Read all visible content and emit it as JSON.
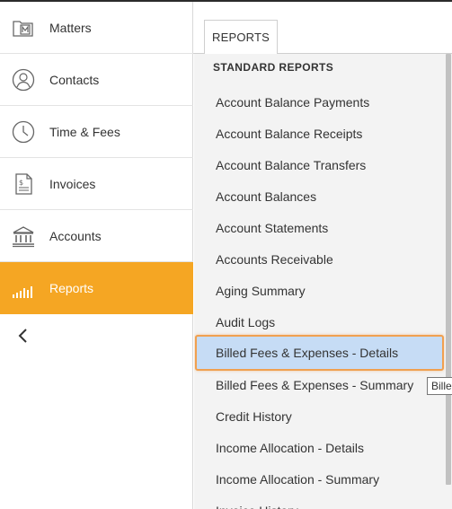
{
  "sidebar": {
    "items": [
      {
        "label": "Matters",
        "icon": "matters-icon"
      },
      {
        "label": "Contacts",
        "icon": "contacts-icon"
      },
      {
        "label": "Time & Fees",
        "icon": "clock-icon"
      },
      {
        "label": "Invoices",
        "icon": "invoice-icon"
      },
      {
        "label": "Accounts",
        "icon": "bank-icon"
      },
      {
        "label": "Reports",
        "icon": "bar-chart-icon",
        "active": true
      }
    ],
    "collapse_icon": "chevron-left-icon"
  },
  "tabs": [
    {
      "label": "REPORTS",
      "active": true
    }
  ],
  "panel": {
    "header": "STANDARD REPORTS",
    "items": [
      "Account Balance Payments",
      "Account Balance Receipts",
      "Account Balance Transfers",
      "Account Balances",
      "Account Statements",
      "Accounts Receivable",
      "Aging Summary",
      "Audit Logs",
      "Billed Fees & Expenses - Details",
      "Billed Fees & Expenses - Summary",
      "Credit History",
      "Income Allocation - Details",
      "Income Allocation - Summary",
      "Invoice History"
    ],
    "selected_item": "Billed Fees & Expenses - Details"
  },
  "tooltip": {
    "text": "Billed"
  },
  "colors": {
    "accent": "#f5a623",
    "selection": "#c6dcf5",
    "selection_border": "#f0a050",
    "panel_bg": "#f3f3f3"
  }
}
